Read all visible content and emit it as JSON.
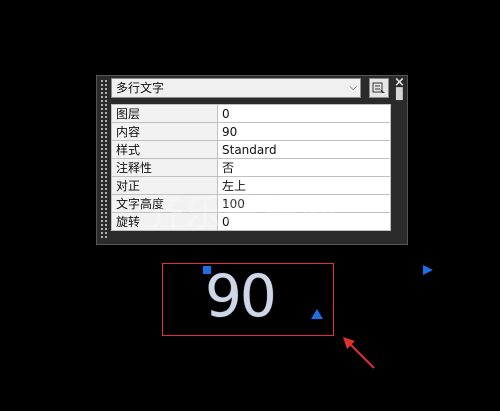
{
  "palette": {
    "object_type": "多行文字",
    "properties": [
      {
        "name": "图层",
        "value": "0"
      },
      {
        "name": "内容",
        "value": "90"
      },
      {
        "name": "样式",
        "value": "Standard"
      },
      {
        "name": "注释性",
        "value": "否"
      },
      {
        "name": "对正",
        "value": "左上"
      },
      {
        "name": "文字高度",
        "value": "100"
      },
      {
        "name": "旋转",
        "value": "0"
      }
    ],
    "close_glyph": "×"
  },
  "canvas": {
    "mtext": "90",
    "watermark": "齐乐教程网",
    "grip_color": "#1e6fe6",
    "selection_color": "#e03030"
  }
}
